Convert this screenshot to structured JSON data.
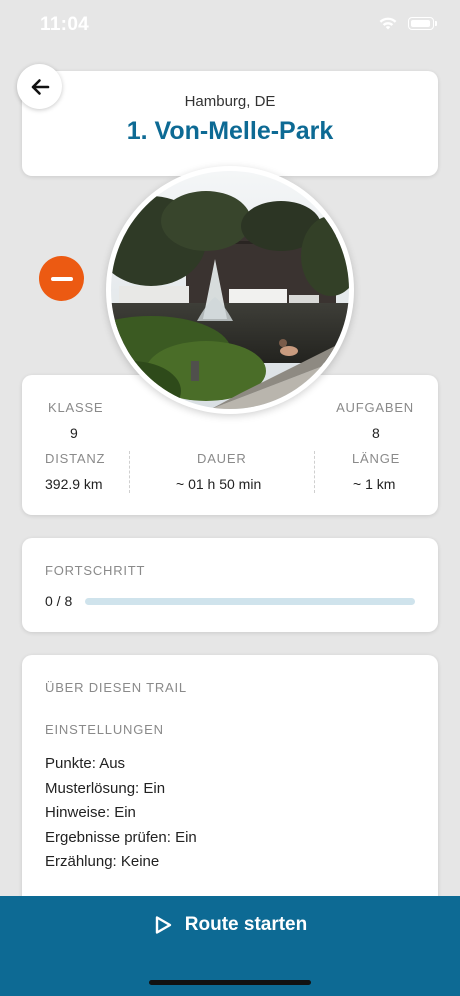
{
  "status_bar": {
    "time": "11:04"
  },
  "header": {
    "location": "Hamburg, DE",
    "title": "1. Von-Melle-Park"
  },
  "stats": {
    "klasse_label": "KLASSE",
    "klasse_value": "9",
    "aufgaben_label": "AUFGABEN",
    "aufgaben_value": "8",
    "distanz_label": "DISTANZ",
    "distanz_value": "392.9 km",
    "dauer_label": "DAUER",
    "dauer_value": "~ 01 h 50 min",
    "laenge_label": "LÄNGE",
    "laenge_value": "~ 1 km"
  },
  "progress": {
    "label": "FORTSCHRITT",
    "count": "0 / 8",
    "fraction": 0
  },
  "about": {
    "title": "ÜBER DIESEN TRAIL",
    "settings_title": "EINSTELLUNGEN",
    "settings": [
      "Punkte: Aus",
      "Musterlösung: Ein",
      "Hinweise: Ein",
      "Ergebnisse prüfen: Ein",
      "Erzählung: Keine"
    ]
  },
  "start_button": {
    "label": "Route starten"
  },
  "colors": {
    "accent": "#0d6a94",
    "remove": "#ec5a12",
    "background": "#e6e6e6"
  },
  "icons": {
    "back": "arrow-left-icon",
    "remove": "minus-icon",
    "start": "play-icon"
  }
}
